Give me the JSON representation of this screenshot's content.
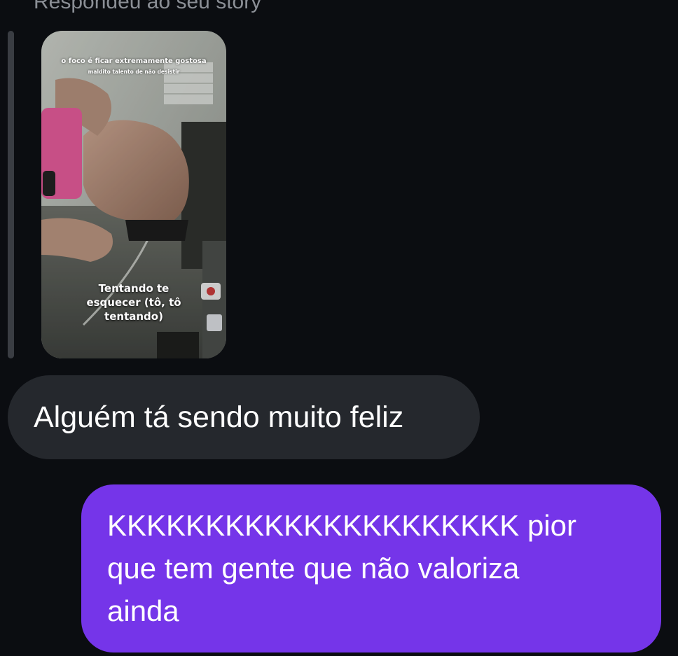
{
  "header": {
    "reply_label": "Respondeu ao seu story"
  },
  "story": {
    "top_line_1": "o foco é ficar extremamente gostosa",
    "top_line_2": "maldito talento de não desistir",
    "caption": "Tentando te esquecer (tô, tô tentando)"
  },
  "messages": {
    "received": {
      "text": "Alguém tá sendo muito feliz"
    },
    "sent": {
      "text": "KKKKKKKKKKKKKKKKKKKKK pior\nque tem gente que não valoriza\nainda"
    }
  },
  "colors": {
    "background": "#0b0d11",
    "received_bubble": "#25282d",
    "sent_bubble": "#7535e9",
    "reply_bar": "#3a3d43",
    "header_text": "#8b8f96"
  }
}
